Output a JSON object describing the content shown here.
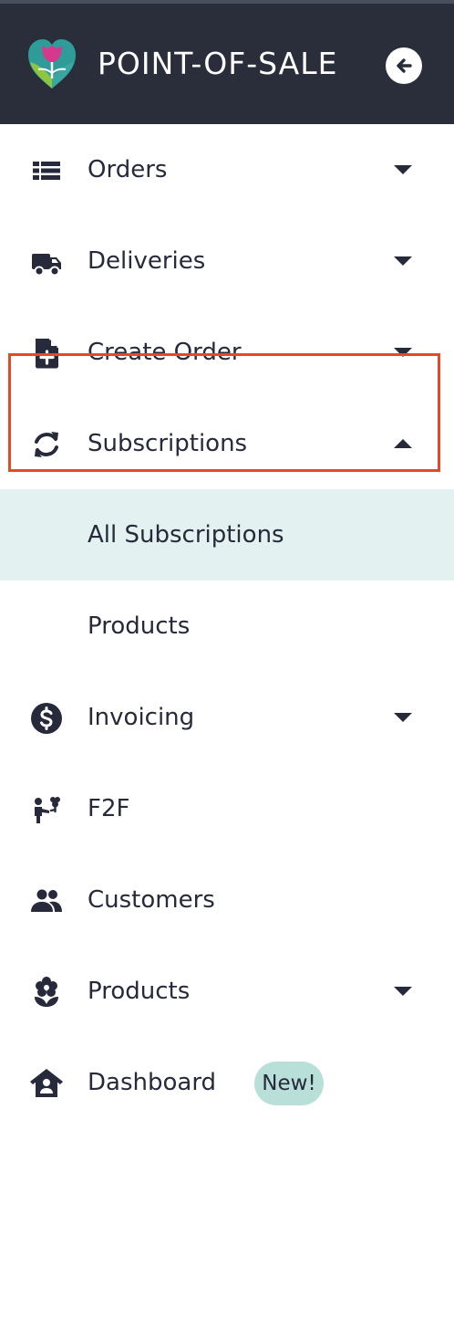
{
  "header": {
    "title": "POINT-OF-SALE",
    "logo_icon": "heart-flower-logo",
    "collapse_icon": "arrow-left-circle-icon"
  },
  "menu": {
    "items": [
      {
        "label": "Orders",
        "icon": "list-icon",
        "caret": "down"
      },
      {
        "label": "Deliveries",
        "icon": "truck-icon",
        "caret": "down"
      },
      {
        "label": "Create Order",
        "icon": "file-plus-icon",
        "caret": "down"
      },
      {
        "label": "Subscriptions",
        "icon": "sync-icon",
        "caret": "up",
        "expanded": true,
        "children": [
          {
            "label": "All Subscriptions",
            "active": true
          },
          {
            "label": "Products",
            "active": false
          }
        ]
      },
      {
        "label": "Invoicing",
        "icon": "dollar-circle-icon",
        "caret": "down"
      },
      {
        "label": "F2F",
        "icon": "person-flower-icon"
      },
      {
        "label": "Customers",
        "icon": "users-icon"
      },
      {
        "label": "Products",
        "icon": "flower-icon",
        "caret": "down"
      },
      {
        "label": "Dashboard",
        "icon": "house-user-icon",
        "badge": "New!"
      }
    ]
  },
  "colors": {
    "header_bg": "#2a2d3a",
    "text": "#262a3b",
    "active_bg": "#e3f1f0",
    "badge_bg": "#b8dfd8",
    "highlight_border": "#e4492a"
  }
}
